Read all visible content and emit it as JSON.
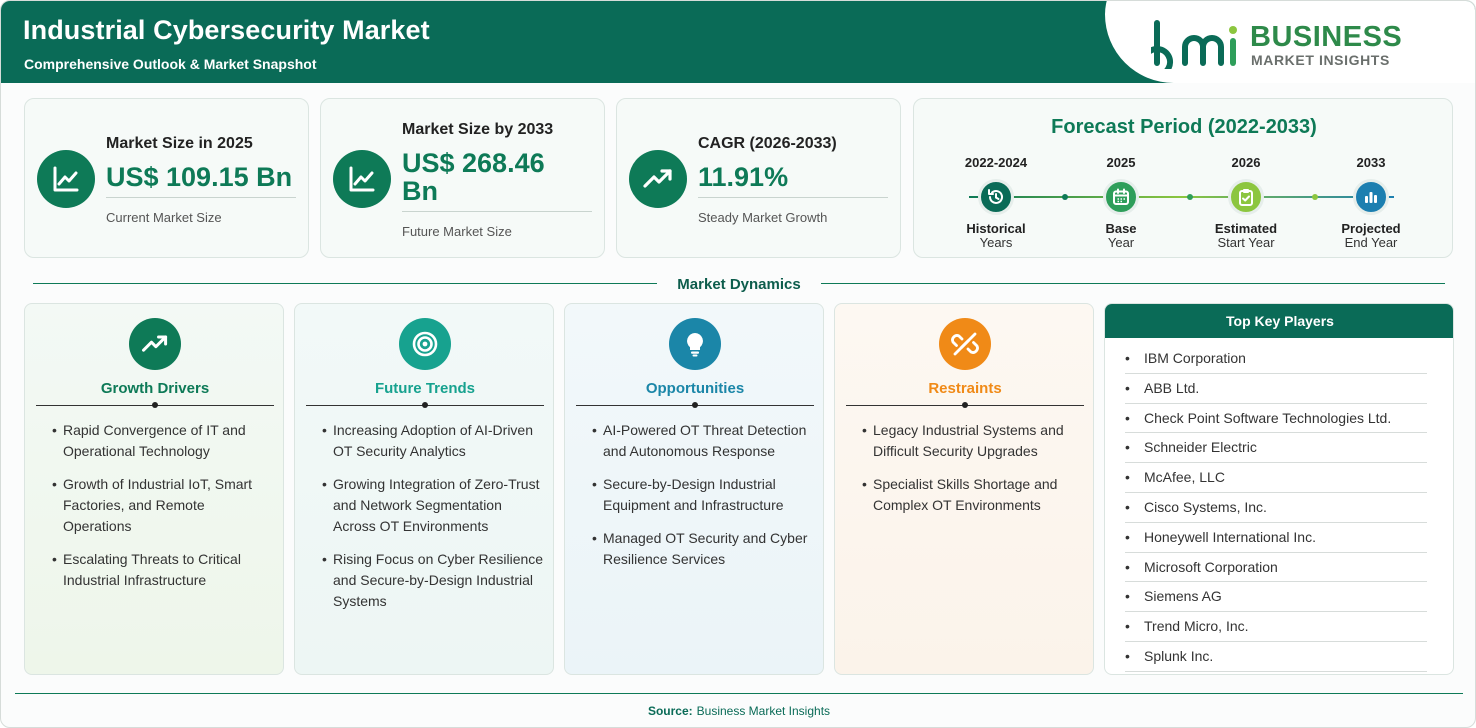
{
  "header": {
    "title": "Industrial Cybersecurity Market",
    "subtitle": "Comprehensive Outlook & Market Snapshot",
    "logo_word": "BUSINESS",
    "logo_sub": "MARKET INSIGHTS"
  },
  "stats": [
    {
      "label": "Market Size in 2025",
      "value": "US$ 109.15 Bn",
      "desc": "Current Market Size",
      "icon": "line-chart-icon"
    },
    {
      "label": "Market Size by 2033",
      "value_l1": "US$ 268.46",
      "value_l2": "Bn",
      "desc": "Future Market Size",
      "icon": "line-chart-icon"
    },
    {
      "label": "CAGR (2026-2033)",
      "value": "11.91%",
      "desc": "Steady Market Growth",
      "icon": "trending-up-icon"
    }
  ],
  "forecast": {
    "title": "Forecast Period (2022-2033)",
    "steps": [
      {
        "year": "2022-2024",
        "name": "Historical",
        "sub": "Years",
        "icon": "history-icon",
        "color": "#0a6b57"
      },
      {
        "year": "2025",
        "name": "Base",
        "sub": "Year",
        "icon": "calendar-icon",
        "color": "#2e9e5a"
      },
      {
        "year": "2026",
        "name": "Estimated",
        "sub": "Start Year",
        "icon": "clipboard-check-icon",
        "color": "#8cc63f"
      },
      {
        "year": "2033",
        "name": "Projected",
        "sub": "End Year",
        "icon": "bar-chart-icon",
        "color": "#1c7fb0"
      }
    ]
  },
  "dynamics": {
    "title": "Market Dynamics",
    "cards": [
      {
        "title": "Growth Drivers",
        "color": "#0e7a57",
        "icon": "trending-up-icon",
        "items": [
          "Rapid Convergence of IT and Operational Technology",
          "Growth of Industrial IoT, Smart Factories, and Remote Operations",
          "Escalating Threats to Critical Industrial Infrastructure"
        ]
      },
      {
        "title": "Future Trends",
        "color": "#17a28f",
        "icon": "target-icon",
        "items": [
          "Increasing Adoption of AI-Driven OT Security Analytics",
          "Growing Integration of Zero-Trust and Network Segmentation Across OT Environments",
          "Rising Focus on Cyber Resilience and Secure-by-Design Industrial Systems"
        ]
      },
      {
        "title": "Opportunities",
        "color": "#1b86a8",
        "icon": "lightbulb-icon",
        "items": [
          "AI-Powered OT Threat Detection and Autonomous Response",
          "Secure-by-Design Industrial Equipment and Infrastructure",
          "Managed OT Security and Cyber Resilience Services"
        ]
      },
      {
        "title": "Restraints",
        "color": "#f08a17",
        "icon": "broken-link-icon",
        "items": [
          "Legacy Industrial Systems and Difficult Security Upgrades",
          "Specialist Skills Shortage and Complex OT Environments"
        ]
      }
    ]
  },
  "key_players": {
    "title": "Top Key Players",
    "items": [
      "IBM Corporation",
      "ABB Ltd.",
      "Check Point Software Technologies Ltd.",
      "Schneider Electric",
      "McAfee, LLC",
      "Cisco Systems, Inc.",
      "Honeywell International Inc.",
      "Microsoft Corporation",
      "Siemens AG",
      "Trend Micro, Inc.",
      "Splunk Inc."
    ]
  },
  "footer": {
    "source_label": "Source:",
    "source_value": "Business Market Insights"
  }
}
